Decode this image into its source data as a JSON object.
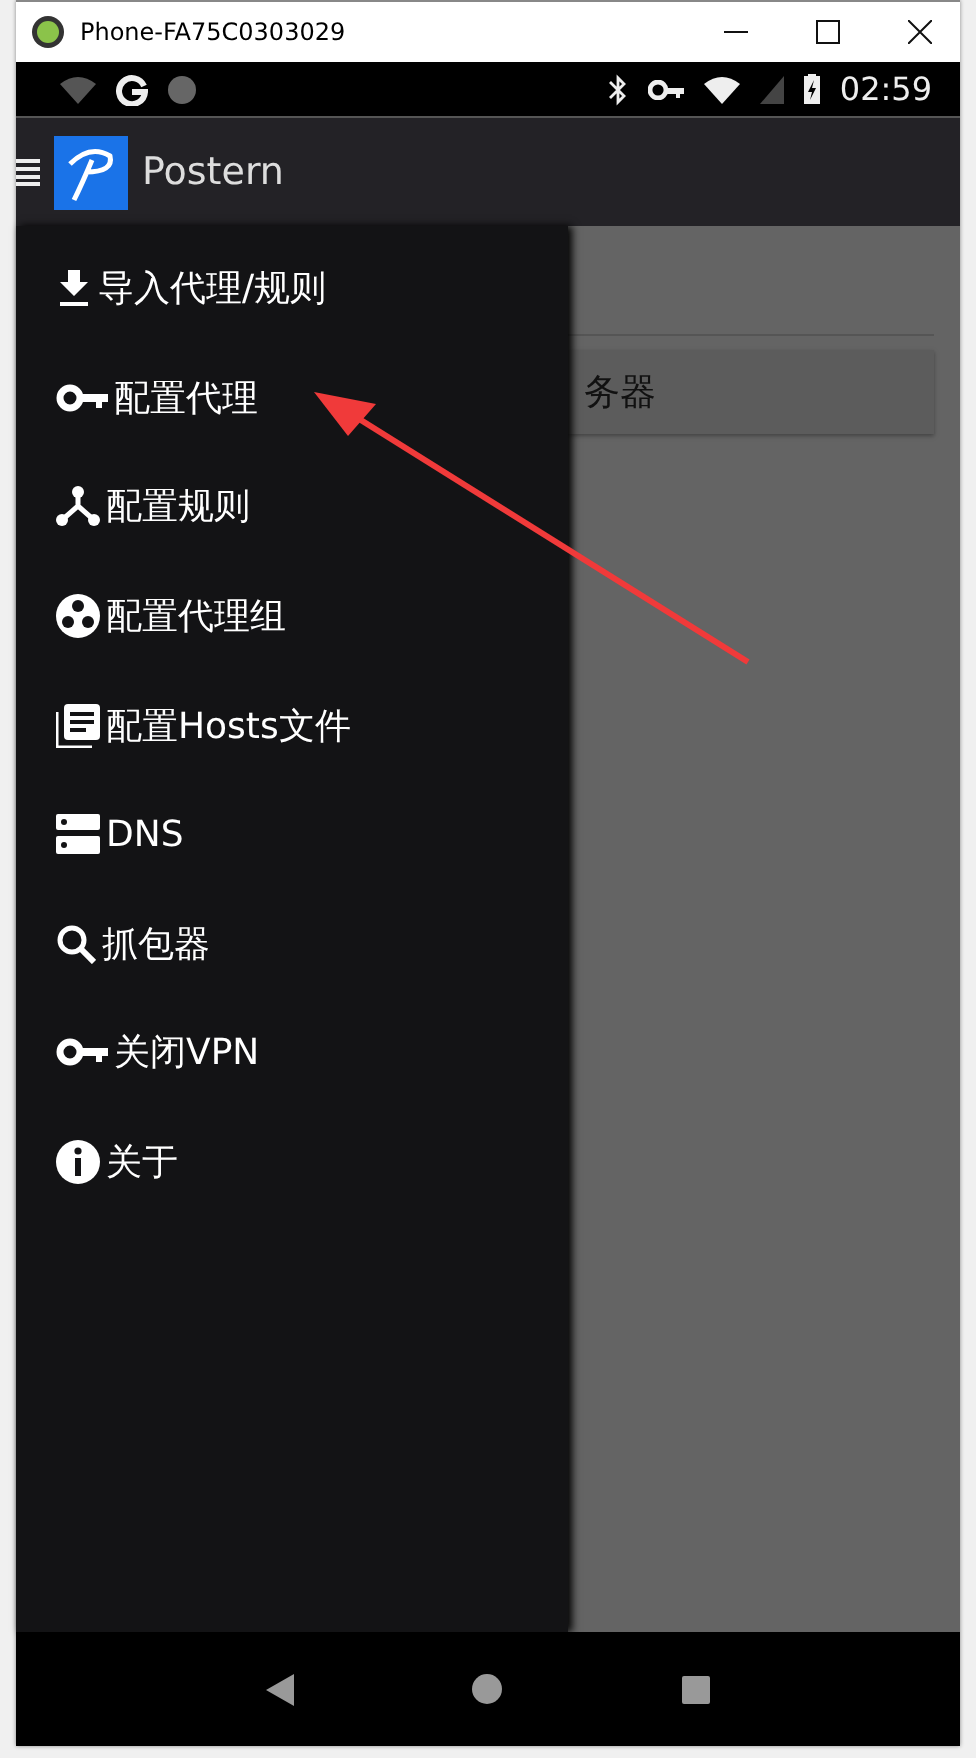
{
  "window": {
    "title": "Phone-FA75C0303029"
  },
  "status_bar": {
    "time": "02:59"
  },
  "app_bar": {
    "title": "Postern"
  },
  "background": {
    "button": "务器"
  },
  "drawer": {
    "items": [
      {
        "kind": "download",
        "label": "导入代理/规则"
      },
      {
        "kind": "key",
        "label": "配置代理"
      },
      {
        "kind": "fork",
        "label": "配置规则"
      },
      {
        "kind": "group",
        "label": "配置代理组"
      },
      {
        "kind": "list",
        "label": "配置Hosts文件"
      },
      {
        "kind": "dns",
        "label": "DNS"
      },
      {
        "kind": "search",
        "label": "抓包器"
      },
      {
        "kind": "key",
        "label": "关闭VPN"
      },
      {
        "kind": "info",
        "label": "关于"
      }
    ]
  }
}
